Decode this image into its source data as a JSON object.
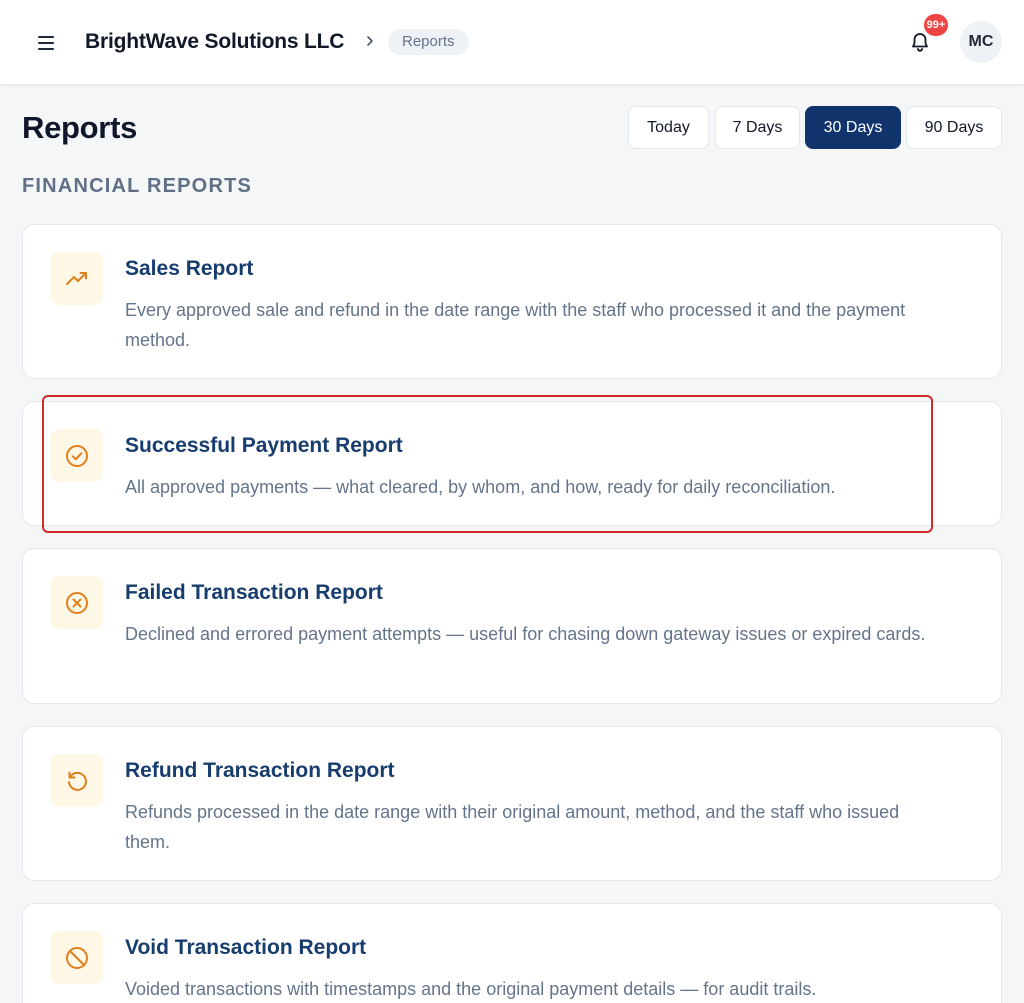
{
  "header": {
    "org_name": "BrightWave Solutions LLC",
    "breadcrumb": "Reports",
    "notification_count": "99+",
    "avatar_initials": "MC"
  },
  "page": {
    "title": "Reports",
    "section_label": "FINANCIAL REPORTS"
  },
  "date_range": {
    "options": [
      "Today",
      "7 Days",
      "30 Days",
      "90 Days"
    ],
    "selected": "30 Days"
  },
  "reports": [
    {
      "icon": "trending-up-icon",
      "title": "Sales Report",
      "description": "Every approved sale and refund in the date range with the staff who processed it and the payment method."
    },
    {
      "icon": "check-circle-icon",
      "title": "Successful Payment Report",
      "description": "All approved payments — what cleared, by whom, and how, ready for daily reconciliation."
    },
    {
      "icon": "x-circle-icon",
      "title": "Failed Transaction Report",
      "description": "Declined and errored payment attempts — useful for chasing down gateway issues or expired cards."
    },
    {
      "icon": "rotate-ccw-icon",
      "title": "Refund Transaction Report",
      "description": "Refunds processed in the date range with their original amount, method, and the staff who issued them."
    },
    {
      "icon": "ban-icon",
      "title": "Void Transaction Report",
      "description": "Voided transactions with timestamps and the original payment details — for audit trails."
    }
  ],
  "colors": {
    "accent_navy": "#10346b",
    "card_title": "#173c6e",
    "icon_orange": "#e0801c",
    "icon_bg": "#fff8e6",
    "badge_red": "#ef4444",
    "highlight_red": "#d02a2a"
  }
}
